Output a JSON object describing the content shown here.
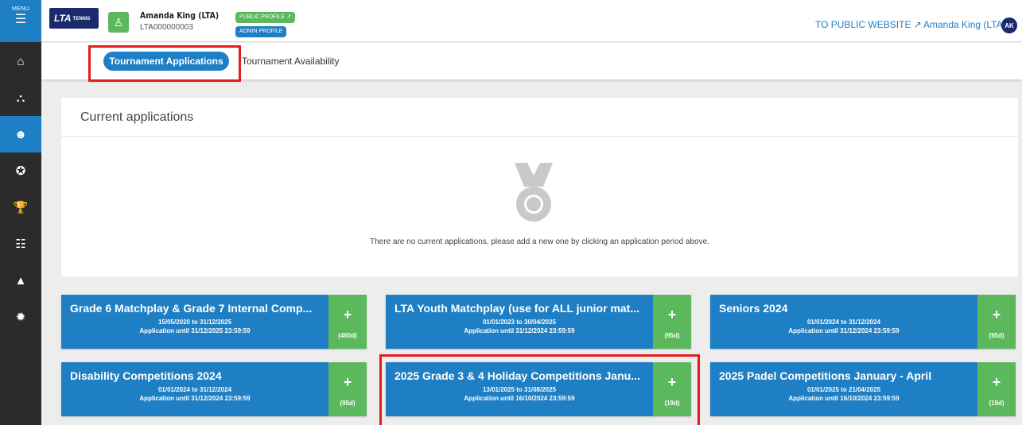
{
  "sidebar": {
    "menu_label": "MENU",
    "items": [
      {
        "icon": "home-icon",
        "glyph": "⌂",
        "active": false
      },
      {
        "icon": "hierarchy-icon",
        "glyph": "⛬",
        "active": false
      },
      {
        "icon": "users-icon",
        "glyph": "☻",
        "active": true
      },
      {
        "icon": "medal-icon",
        "glyph": "✪",
        "active": false
      },
      {
        "icon": "trophy-icon",
        "glyph": "🏆",
        "active": false
      },
      {
        "icon": "ladder-icon",
        "glyph": "☷",
        "active": false
      },
      {
        "icon": "warning-icon",
        "glyph": "▲",
        "active": false
      },
      {
        "icon": "gear-icon",
        "glyph": "✹",
        "active": false
      }
    ]
  },
  "header": {
    "logo_text": "LTA",
    "logo_sub": "TENNIS",
    "user_name": "Amanda King (LTA)",
    "user_id": "LTA000000003",
    "public_profile": "PUBLIC PROFILE ↗",
    "admin_profile": "ADMIN PROFILE",
    "to_public_website": "TO PUBLIC WEBSITE ↗",
    "user_right": "Amanda King (LTA)",
    "initials": "AK"
  },
  "tabs": {
    "active": "Tournament Applications",
    "other": "Tournament Availability"
  },
  "current": {
    "title": "Current applications",
    "empty_message": "There are no current applications, please add a new one by clicking an application period above."
  },
  "cards": [
    {
      "title": "Grade 6 Matchplay & Grade 7 Internal Comp...",
      "dates": "15/05/2020 to 31/12/2025",
      "until": "Application until 31/12/2025 23:59:59",
      "days": "(460d)"
    },
    {
      "title": "LTA Youth Matchplay (use for ALL junior mat...",
      "dates": "01/01/2023 to 30/04/2025",
      "until": "Application until 31/12/2024 23:59:59",
      "days": "(95d)"
    },
    {
      "title": "Seniors 2024",
      "dates": "01/01/2024 to 31/12/2024",
      "until": "Application until 31/12/2024 23:59:59",
      "days": "(95d)"
    },
    {
      "title": "Disability Competitions 2024",
      "dates": "01/01/2024 to 31/12/2024",
      "until": "Application until 31/12/2024 23:59:59",
      "days": "(95d)"
    },
    {
      "title": "2025 Grade 3 & 4 Holiday Competitions Janu...",
      "dates": "13/01/2025 to 31/08/2025",
      "until": "Application until 16/10/2024 23:59:59",
      "days": "(19d)"
    },
    {
      "title": "2025 Padel Competitions January - April",
      "dates": "01/01/2025 to 21/04/2025",
      "until": "Application until 16/10/2024 23:59:59",
      "days": "(19d)"
    }
  ],
  "colors": {
    "primary": "#1f7fc4",
    "success": "#5cb85c",
    "highlight": "#e11d1d",
    "sidebar": "#2b2b2b"
  }
}
